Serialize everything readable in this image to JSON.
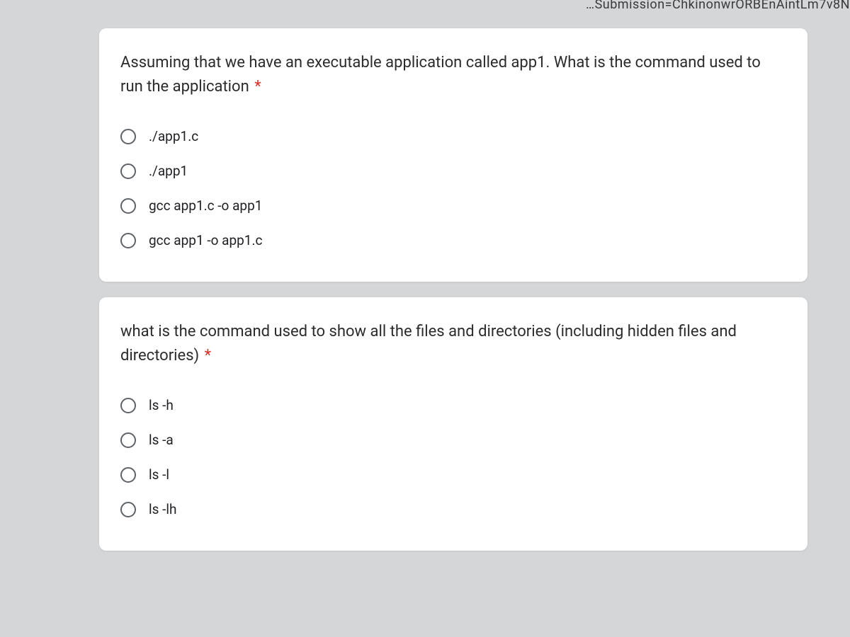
{
  "url_fragment_text": "…Submission=ChkinonwrORBEnAintLm7v8N",
  "required_marker": "*",
  "questions": [
    {
      "prompt": "Assuming that we have an executable application called app1. What is the command used to run the application",
      "options": [
        "./app1.c",
        "./app1",
        "gcc app1.c -o app1",
        "gcc app1 -o app1.c"
      ]
    },
    {
      "prompt": "what is the command used to show all the files and directories (including hidden files and directories)",
      "options": [
        "ls -h",
        "ls -a",
        "ls -l",
        "ls -lh"
      ]
    }
  ]
}
